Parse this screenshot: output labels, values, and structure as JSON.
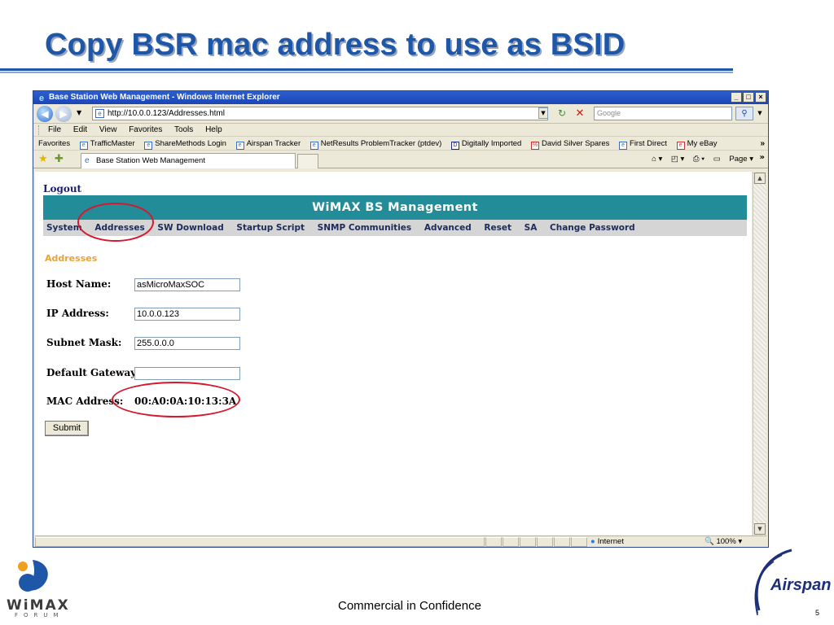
{
  "slide": {
    "title": "Copy BSR mac address to use as BSID",
    "footer_text": "Commercial in Confidence",
    "page_number": "5",
    "wimax_logo_text": "WiMAX",
    "wimax_logo_subtext": "FORUM",
    "airspan_logo_text": "Airspan",
    "accent_color": "#1f57a8",
    "highlight_color": "#d6182f"
  },
  "browser": {
    "window_title": "Base Station Web Management - Windows Internet Explorer",
    "url": "http://10.0.0.123/Addresses.html",
    "search_placeholder": "Google",
    "menu": [
      "File",
      "Edit",
      "View",
      "Favorites",
      "Tools",
      "Help"
    ],
    "favorites": [
      "Favorites",
      "TrafficMaster",
      "ShareMethods Login",
      "Airspan Tracker",
      "NetResults ProblemTracker (ptdev)",
      "Digitally Imported",
      "David Silver Spares",
      "First Direct",
      "My eBay"
    ],
    "tab_title": "Base Station Web Management",
    "page_menu_label": "Page",
    "status_zone": "Internet",
    "zoom": "100%"
  },
  "page": {
    "logout": "Logout",
    "banner": "WiMAX BS Management",
    "nav": [
      "System",
      "Addresses",
      "SW Download",
      "Startup Script",
      "SNMP Communities",
      "Advanced",
      "Reset",
      "SA",
      "Change Password"
    ],
    "section_title": "Addresses",
    "fields": {
      "host_name_label": "Host Name:",
      "host_name_value": "asMicroMaxSOC",
      "ip_label": "IP Address:",
      "ip_value": "10.0.0.123",
      "subnet_label": "Subnet Mask:",
      "subnet_value": "255.0.0.0",
      "gateway_label": "Default Gateway:",
      "gateway_value": "",
      "mac_label": "MAC Address:",
      "mac_value": "00:A0:0A:10:13:3A"
    },
    "submit_label": "Submit"
  }
}
